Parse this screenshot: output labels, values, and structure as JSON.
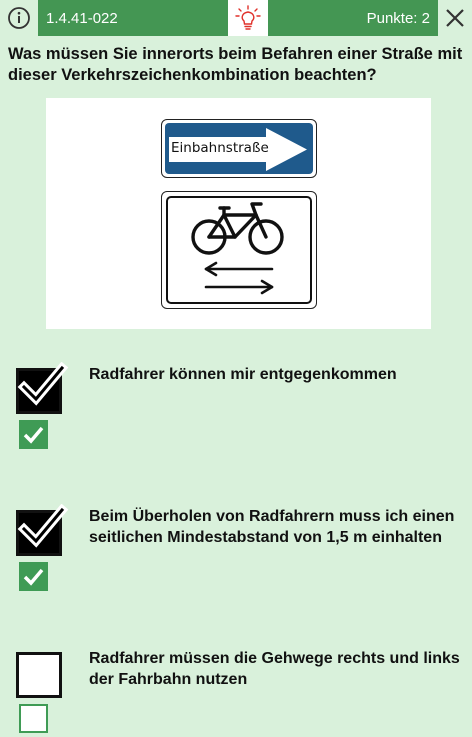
{
  "header": {
    "question_id": "1.4.41-022",
    "points_text": "Punkte: 2"
  },
  "question": {
    "text": "Was müssen Sie innerorts beim Befahren einer Straße mit dieser Verkehrszeichenkombination beachten?"
  },
  "signs": {
    "one_way_label": "Einbahnstraße"
  },
  "answers": [
    {
      "text": "Radfahrer können mir entgegenkommen",
      "selected": true,
      "correct": true
    },
    {
      "text": "Beim Überholen von Radfahrern muss ich einen seitlichen Mindestabstand von 1,5 m einhalten",
      "selected": true,
      "correct": true
    },
    {
      "text": "Radfahrer müssen die Gehwege rechts und links der Fahrbahn nutzen",
      "selected": false,
      "correct": false
    }
  ],
  "colors": {
    "background": "#d9f1db",
    "header_green": "#449653",
    "check_green": "#3f9b55",
    "sign_blue": "#1f5a8c",
    "hint_red": "#e0302a"
  }
}
